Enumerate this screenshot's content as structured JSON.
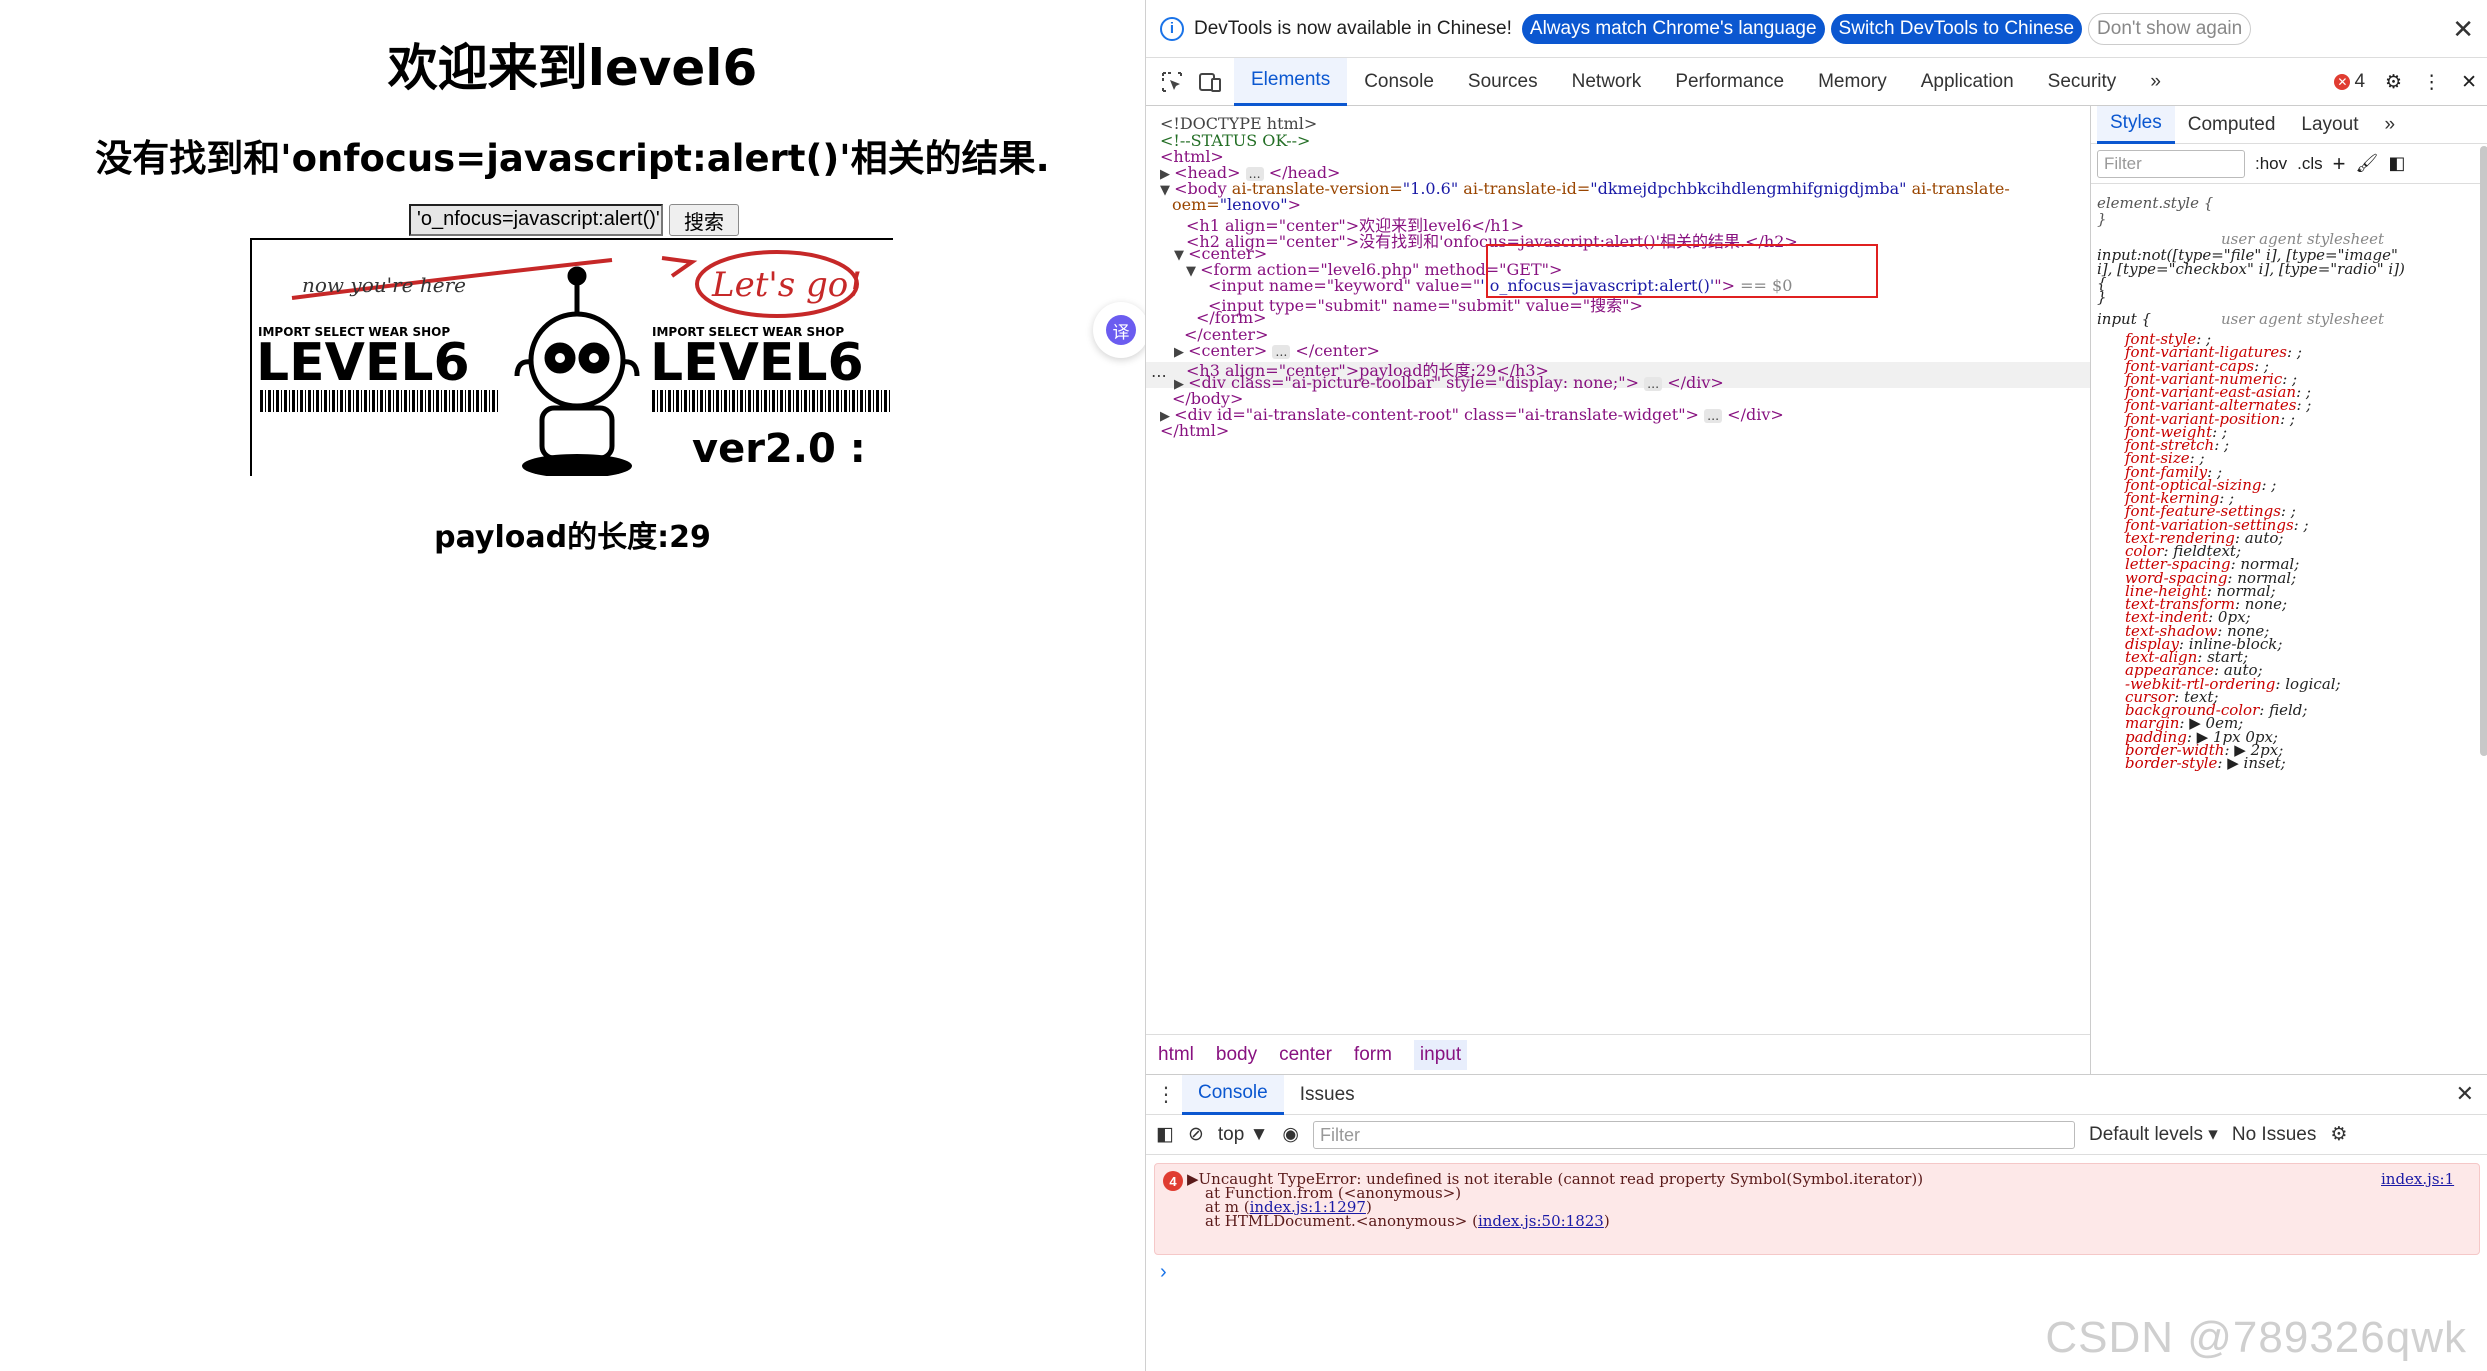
{
  "page": {
    "title": "欢迎来到level6",
    "result_text": "没有找到和'onfocus=javascript:alert()'相关的结果.",
    "keyword_value": "'o_nfocus=javascript:alert()'",
    "submit_label": "搜索",
    "banner": {
      "now": "now you're here",
      "lets_go": "Let's go!",
      "shop": "IMPORT SELECT WEAR SHOP",
      "level": "LEVEL6",
      "version": "ver2.0 :"
    },
    "payload_len": "payload的长度:29",
    "translate_icon": "译"
  },
  "devtools": {
    "infobar": {
      "message": "DevTools is now available in Chinese!",
      "btn1": "Always match Chrome's language",
      "btn2": "Switch DevTools to Chinese",
      "btn3": "Don't show again"
    },
    "tabs": [
      "Elements",
      "Console",
      "Sources",
      "Network",
      "Performance",
      "Memory",
      "Application",
      "Security"
    ],
    "more": "»",
    "error_count": "4",
    "dom": {
      "doctype": "<!DOCTYPE html>",
      "comment": "<!--STATUS OK-->",
      "html_open": "<html>",
      "head": "<head>",
      "head_close": "</head>",
      "body_tag": "<body",
      "body_attr1": " ai-translate-version=",
      "body_val1": "\"1.0.6\"",
      "body_attr2": " ai-translate-id=",
      "body_val2": "\"dkmejdpchbkcihdlengmhifgnigdjmba\"",
      "body_attr3": " ai-translate-",
      "body_attr3b": "oem=",
      "body_val3": "\"lenovo\"",
      "h1_line": "<h1 align=\"center\">欢迎来到level6</h1>",
      "h2_line": "<h2 align=\"center\">没有找到和'onfocus=javascript:alert()'相关的结果.</h2>",
      "center_open": "<center>",
      "form_line": "<form action=\"level6.php\" method=\"GET\">",
      "input1_a": "<input name=\"keyword\" value=\"",
      "input1_b": "' o_nfocus=javascript:alert()'",
      "input1_c": "\">",
      "input1_eq": "== $0",
      "input2": "<input type=\"submit\" name=\"submit\" value=\"搜索\">",
      "form_close": "</form>",
      "center_close": "</center>",
      "center2_open": "<center>",
      "center2_close": "</center>",
      "h3_line": "<h3 align=\"center\">payload的长度:29</h3>",
      "div_toolbar": "<div class=\"ai-picture-toolbar\" style=\"display: none;\">",
      "div_close": "</div>",
      "body_close": "</body>",
      "div_root": "<div id=\"ai-translate-content-root\" class=\"ai-translate-widget\">",
      "html_close": "</html>",
      "ellipsis": "…"
    },
    "breadcrumbs": [
      "html",
      "body",
      "center",
      "form",
      "input"
    ],
    "styles": {
      "tabs": [
        "Styles",
        "Computed",
        "Layout"
      ],
      "filter_placeholder": "Filter",
      "hov": ":hov",
      "cls": ".cls",
      "element_style": "element.style {",
      "close_brace": "}",
      "ua": "user agent stylesheet",
      "rule1_sel": "input:not([type=\"file\" i], [type=\"image\"",
      "rule1_sel2": "i], [type=\"checkbox\" i], [type=\"radio\" i])",
      "rule1_brace": "{",
      "rule2_sel": "input {",
      "props": [
        [
          "font-style",
          ";"
        ],
        [
          "font-variant-ligatures",
          ";"
        ],
        [
          "font-variant-caps",
          ";"
        ],
        [
          "font-variant-numeric",
          ";"
        ],
        [
          "font-variant-east-asian",
          ";"
        ],
        [
          "font-variant-alternates",
          ";"
        ],
        [
          "font-variant-position",
          ";"
        ],
        [
          "font-weight",
          ";"
        ],
        [
          "font-stretch",
          ";"
        ],
        [
          "font-size",
          ";"
        ],
        [
          "font-family",
          ";"
        ],
        [
          "font-optical-sizing",
          ";"
        ],
        [
          "font-kerning",
          ";"
        ],
        [
          "font-feature-settings",
          ";"
        ],
        [
          "font-variation-settings",
          ";"
        ],
        [
          "text-rendering",
          "auto;"
        ],
        [
          "color",
          "fieldtext;"
        ],
        [
          "letter-spacing",
          "normal;"
        ],
        [
          "word-spacing",
          "normal;"
        ],
        [
          "line-height",
          "normal;"
        ],
        [
          "text-transform",
          "none;"
        ],
        [
          "text-indent",
          "0px;"
        ],
        [
          "text-shadow",
          "none;"
        ],
        [
          "display",
          "inline-block;"
        ],
        [
          "text-align",
          "start;"
        ],
        [
          "appearance",
          "auto;"
        ],
        [
          "-webkit-rtl-ordering",
          "logical;"
        ],
        [
          "cursor",
          "text;"
        ],
        [
          "background-color",
          "field;"
        ],
        [
          "margin",
          "▶ 0em;"
        ],
        [
          "padding",
          "▶ 1px 0px;"
        ],
        [
          "border-width",
          "▶ 2px;"
        ],
        [
          "border-style",
          "▶ inset;"
        ]
      ]
    },
    "console": {
      "tabs": [
        "Console",
        "Issues"
      ],
      "context": "top ▼",
      "filter_placeholder": "Filter",
      "levels": "Default levels ▾",
      "issues": "No Issues",
      "err_count": "4",
      "err_line1": "▶Uncaught TypeError: undefined is not iterable (cannot read property Symbol(Symbol.iterator))",
      "err_link1": "index.js:1",
      "err_line2": "at Function.from (<anonymous>)",
      "err_line3a": "at m (",
      "err_link3": "index.js:1:1297",
      "err_line3b": ")",
      "err_line4a": "at HTMLDocument.<anonymous> (",
      "err_link4": "index.js:50:1823",
      "err_line4b": ")",
      "prompt": "›"
    }
  },
  "watermark": "CSDN @789326qwk",
  "colors": {
    "accent": "#0b57d0",
    "error": "#e03c31",
    "tag": "#881280",
    "attr": "#994500",
    "val": "#1a1aa6",
    "comment": "#236e25",
    "prop": "#c80000",
    "highlight_box": "#e02020"
  }
}
